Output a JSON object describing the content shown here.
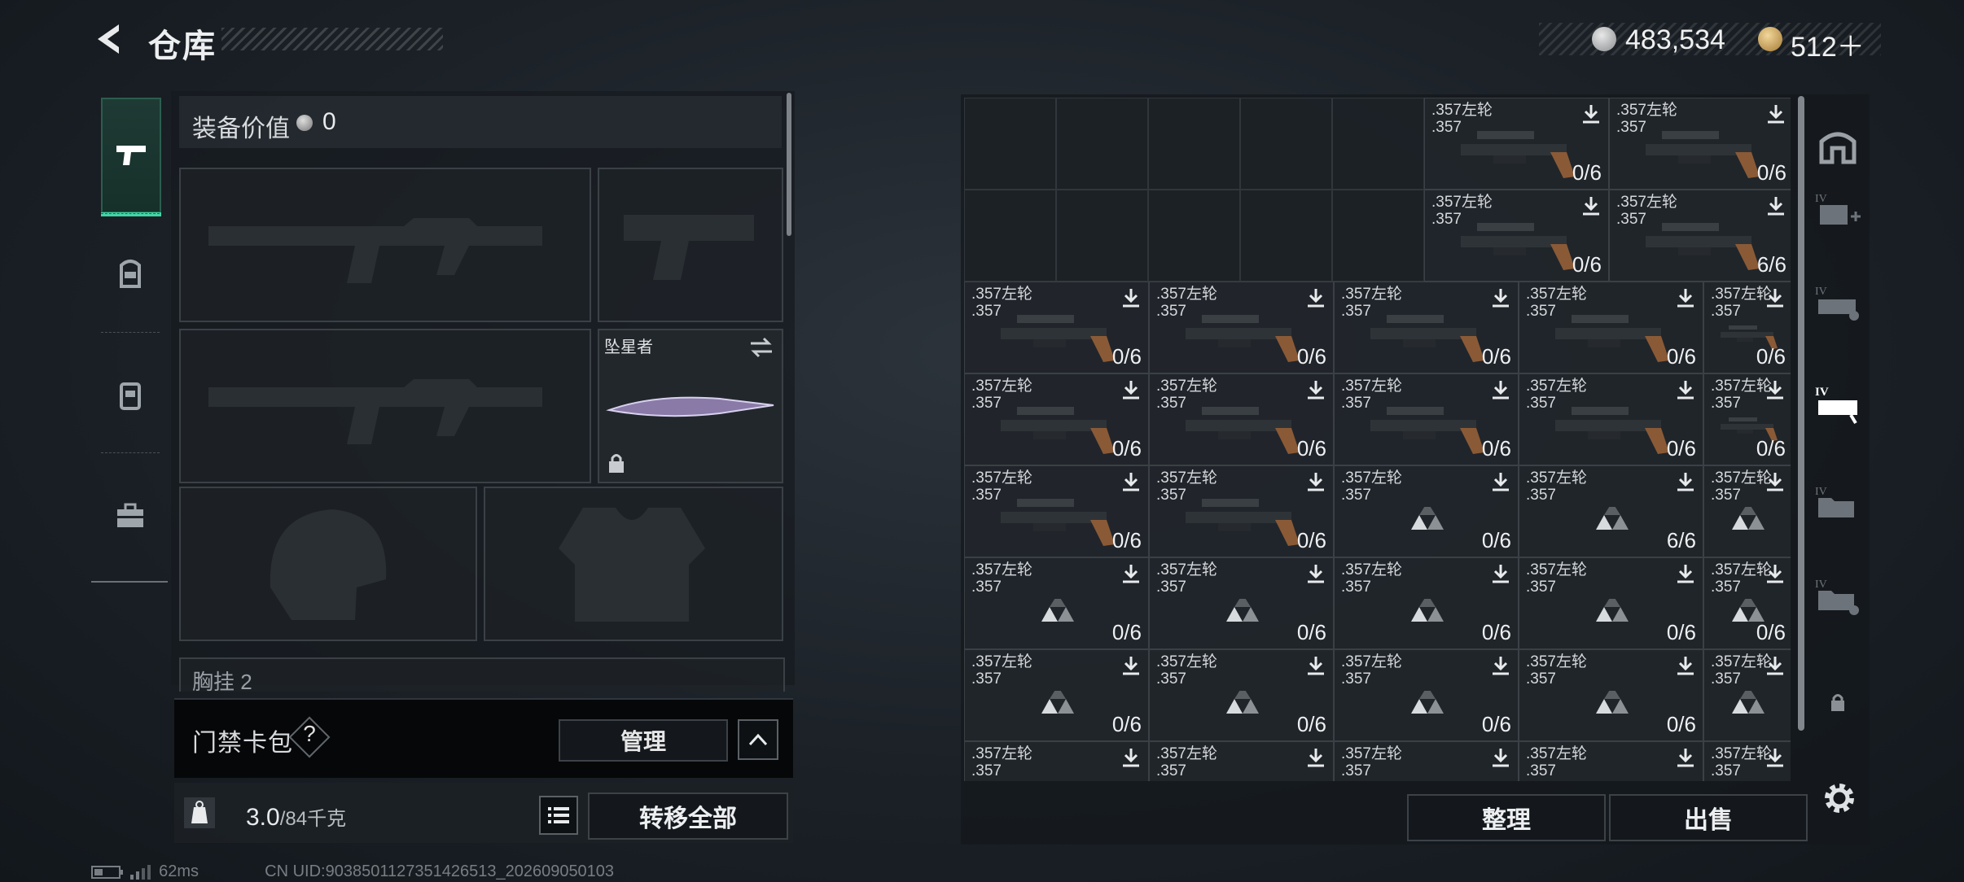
{
  "header": {
    "title": "仓库",
    "money": "483,534",
    "gold": "512＋"
  },
  "loadout": {
    "value_label": "装备价值",
    "value": "0",
    "melee_name": "坠星者",
    "chest_label": "胸挂 2",
    "card_label": "门禁卡包",
    "card_help": "?",
    "manage_label": "管理",
    "weight_value": "3.0",
    "weight_max": "/84千克",
    "transfer_all_label": "转移全部"
  },
  "status": {
    "ping": "62ms",
    "uid": "CN UID:9038501127351426513_202609050103"
  },
  "stash": {
    "sort_label": "整理",
    "sell_label": "出售",
    "item_name": ".357左轮\n.357",
    "rows": [
      [
        "",
        "",
        "",
        "",
        "",
        "0/6",
        "0/6"
      ],
      [
        "",
        "",
        "",
        "",
        "",
        "0/6",
        "6/6"
      ],
      [
        "0/6",
        "0/6",
        "0/6",
        "0/6",
        "0/6"
      ],
      [
        "0/6",
        "0/6",
        "0/6",
        "0/6",
        "0/6"
      ],
      [
        "0/6",
        "0/6",
        "0/6",
        "6/6",
        ""
      ],
      [
        "0/6",
        "0/6",
        "0/6",
        "0/6",
        "0/6"
      ],
      [
        "0/6",
        "0/6",
        "0/6",
        "0/6",
        ""
      ],
      [
        "",
        "",
        "",
        "",
        ""
      ]
    ]
  },
  "colors": {
    "accent": "#3fd6a6",
    "panel": "#1a1f24",
    "border": "#3a4046"
  },
  "icons": [
    "back-arrow-icon",
    "silver-coin-icon",
    "gold-coin-icon",
    "pistol-icon",
    "helmet-backpack-icon",
    "vest-icon",
    "case-icon",
    "download-icon",
    "triangle-icon",
    "lock-icon",
    "swap-icon",
    "weight-icon",
    "list-icon",
    "settings-icon",
    "storage-icon",
    "medkit-icon",
    "weapon-case-icon"
  ]
}
